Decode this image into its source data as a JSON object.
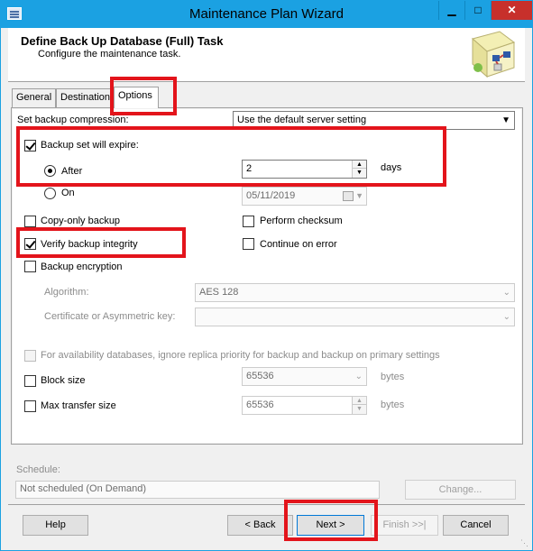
{
  "window": {
    "title": "Maintenance Plan Wizard",
    "minimize_glyph": "▁",
    "maximize_glyph": "□",
    "close_glyph": "✕"
  },
  "header": {
    "title": "Define Back Up Database (Full) Task",
    "subtitle": "Configure the maintenance task."
  },
  "tabs": [
    {
      "label": "General"
    },
    {
      "label": "Destination"
    },
    {
      "label": "Options"
    }
  ],
  "options": {
    "compression_label": "Set backup compression:",
    "compression_value": "Use the default server setting",
    "expire_label": "Backup set will expire:",
    "expire_checked": true,
    "after_label": "After",
    "after_value": "2",
    "days_label": "days",
    "on_label": "On",
    "on_date": "05/11/2019",
    "copy_only_label": "Copy-only backup",
    "perform_checksum_label": "Perform checksum",
    "verify_label": "Verify backup integrity",
    "verify_checked": true,
    "continue_on_error_label": "Continue on error",
    "encryption_label": "Backup encryption",
    "algorithm_label": "Algorithm:",
    "algorithm_value": "AES 128",
    "certificate_label": "Certificate or Asymmetric key:",
    "certificate_value": "",
    "availability_label": "For availability databases, ignore replica priority for backup and backup on primary settings",
    "block_size_label": "Block size",
    "block_size_value": "65536",
    "max_transfer_label": "Max transfer size",
    "max_transfer_value": "65536",
    "bytes_label": "bytes"
  },
  "schedule": {
    "label": "Schedule:",
    "value": "Not scheduled (On Demand)",
    "change_label": "Change..."
  },
  "footer": {
    "help": "Help",
    "back": "< Back",
    "next": "Next >",
    "finish": "Finish >>|",
    "cancel": "Cancel"
  },
  "colors": {
    "titlebar": "#1ba1e2",
    "close": "#c7302b",
    "annotation": "#e3141b"
  }
}
